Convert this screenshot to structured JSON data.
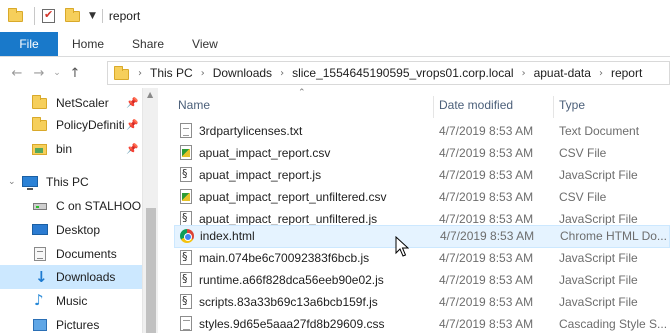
{
  "window": {
    "title": "report"
  },
  "ribbon": {
    "tabs": [
      "File",
      "Home",
      "Share",
      "View"
    ]
  },
  "address": {
    "crumbs": [
      "This PC",
      "Downloads",
      "slice_1554645190595_vrops01.corp.local",
      "apuat-data",
      "report"
    ]
  },
  "nav": {
    "items": [
      {
        "label": "NetScaler",
        "icon": "folder-icon",
        "pinned": true
      },
      {
        "label": "PolicyDefiniti",
        "icon": "folder-icon",
        "pinned": true
      },
      {
        "label": "bin",
        "icon": "folder-icon",
        "pinned": true
      },
      {
        "label": "This PC",
        "icon": "computer-icon"
      },
      {
        "label": "C on STALHOOD",
        "icon": "network-drive-icon"
      },
      {
        "label": "Desktop",
        "icon": "desktop-icon"
      },
      {
        "label": "Documents",
        "icon": "documents-icon"
      },
      {
        "label": "Downloads",
        "icon": "downloads-icon",
        "selected": true
      },
      {
        "label": "Music",
        "icon": "music-icon"
      },
      {
        "label": "Pictures",
        "icon": "pictures-icon"
      }
    ]
  },
  "columns": {
    "name": "Name",
    "date": "Date modified",
    "type": "Type"
  },
  "files": [
    {
      "name": "3rdpartylicenses.txt",
      "date": "4/7/2019 8:53 AM",
      "type": "Text Document",
      "icon": "text-file-icon"
    },
    {
      "name": "apuat_impact_report.csv",
      "date": "4/7/2019 8:53 AM",
      "type": "CSV File",
      "icon": "csv-file-icon"
    },
    {
      "name": "apuat_impact_report.js",
      "date": "4/7/2019 8:53 AM",
      "type": "JavaScript File",
      "icon": "js-file-icon"
    },
    {
      "name": "apuat_impact_report_unfiltered.csv",
      "date": "4/7/2019 8:53 AM",
      "type": "CSV File",
      "icon": "csv-file-icon"
    },
    {
      "name": "apuat_impact_report_unfiltered.js",
      "date": "4/7/2019 8:53 AM",
      "type": "JavaScript File",
      "icon": "js-file-icon"
    },
    {
      "name": "index.html",
      "date": "4/7/2019 8:53 AM",
      "type": "Chrome HTML Do...",
      "icon": "chrome-html-icon",
      "hover": true
    },
    {
      "name": "main.074be6c70092383f6bcb.js",
      "date": "4/7/2019 8:53 AM",
      "type": "JavaScript File",
      "icon": "js-file-icon"
    },
    {
      "name": "runtime.a66f828dca56eeb90e02.js",
      "date": "4/7/2019 8:53 AM",
      "type": "JavaScript File",
      "icon": "js-file-icon"
    },
    {
      "name": "scripts.83a33b69c13a6bcb159f.js",
      "date": "4/7/2019 8:53 AM",
      "type": "JavaScript File",
      "icon": "js-file-icon"
    },
    {
      "name": "styles.9d65e5aaa27fd8b29609.css",
      "date": "4/7/2019 8:53 AM",
      "type": "Cascading Style S...",
      "icon": "css-file-icon"
    }
  ]
}
